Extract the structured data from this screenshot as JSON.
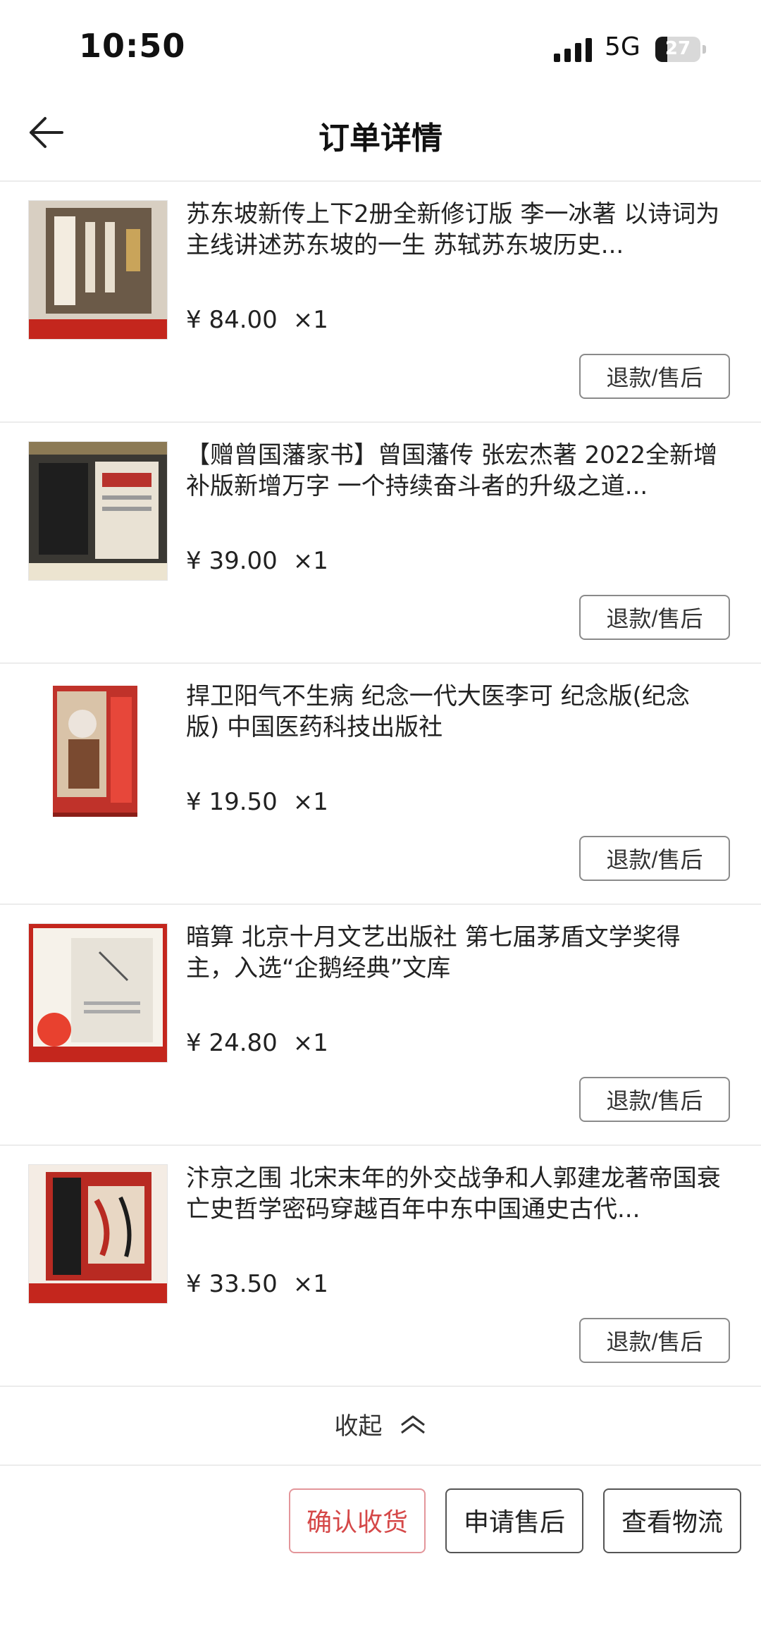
{
  "status_bar": {
    "time": "10:50",
    "network": "5G",
    "battery": "27",
    "battery_level": 0.27
  },
  "header": {
    "title": "订单详情",
    "back_icon": "arrow-left-icon"
  },
  "items": [
    {
      "name": "苏东坡新传上下2册全新修订版 李一冰著 以诗词为主线讲述苏东坡的一生 苏轼苏东坡历史...",
      "price": "¥ 84.00",
      "qty": "×1",
      "action": "退款/售后",
      "cover_color": "#6b5a48"
    },
    {
      "name": "【赠曾国藩家书】曾国藩传 张宏杰著 2022全新增补版新增万字 一个持续奋斗者的升级之道...",
      "price": "¥ 39.00",
      "qty": "×1",
      "action": "退款/售后",
      "cover_color": "#2a2a2a"
    },
    {
      "name": "捍卫阳气不生病 纪念一代大医李可 纪念版(纪念版) 中国医药科技出版社",
      "price": "¥ 19.50",
      "qty": "×1",
      "action": "退款/售后",
      "cover_color": "#c0322a"
    },
    {
      "name": "暗算 北京十月文艺出版社 第七届茅盾文学奖得主，入选“企鹅经典”文库",
      "price": "¥ 24.80",
      "qty": "×1",
      "action": "退款/售后",
      "cover_color": "#e7e2d8"
    },
    {
      "name": "汴京之围 北宋末年的外交战争和人郭建龙著帝国衰亡史哲学密码穿越百年中东中国通史古代...",
      "price": "¥ 33.50",
      "qty": "×1",
      "action": "退款/售后",
      "cover_color": "#b82a22"
    }
  ],
  "collapse": {
    "label": "收起",
    "icon": "chevron-up-icon"
  },
  "actions": {
    "confirm": "确认收货",
    "after_sale": "申请售后",
    "logistics": "查看物流",
    "accent_color": "#d54848"
  }
}
